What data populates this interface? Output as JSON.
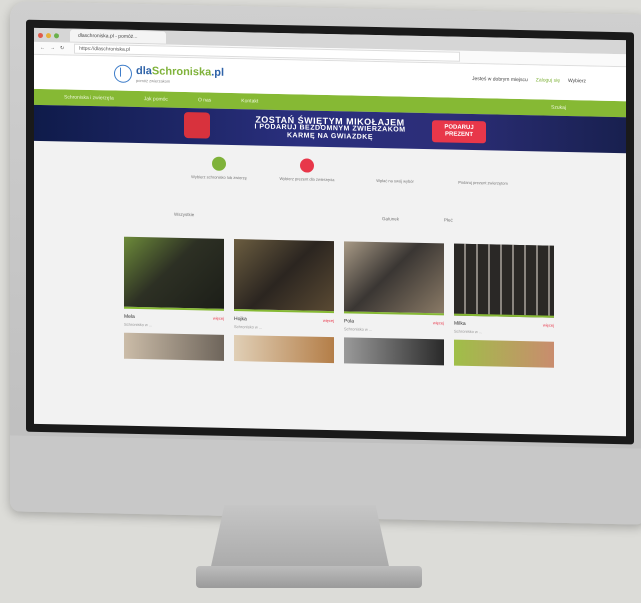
{
  "browser": {
    "tab_title": "dlaschroniska.pl - pomóż...",
    "url": "https://dlaschroniska.pl"
  },
  "site": {
    "logo_prefix": "dla",
    "logo_accent": "Schroniska",
    "logo_suffix": ".pl",
    "tagline": "pomóż zwierzakom",
    "header_links": [
      "Jesteś w dobrym miejscu",
      "Zaloguj się",
      "Wybierz"
    ]
  },
  "nav": {
    "items": [
      "Schroniska i zwierzęta",
      "Jak pomóc",
      "O nas",
      "Kontakt"
    ],
    "right": "Szukaj"
  },
  "banner": {
    "line1": "ZOSTAŃ ŚWIĘTYM MIKOŁAJEM",
    "line2": "I PODARUJ BEZDOMNYM ZWIERZAKOM",
    "line3": "KARMĘ NA GWIAZDKĘ",
    "cta1": "PODARUJ",
    "cta2": "PREZENT"
  },
  "steps": [
    {
      "label": "Wybierz schronisko lub zwierzę",
      "color": "#7fb23a"
    },
    {
      "label": "Wybierz prezent dla zwierzęcia",
      "color": "#e8374a"
    },
    {
      "label": "Wpłać na swój wybór",
      "color": "#f2f2f2"
    },
    {
      "label": "Podaruj prezent zwierzętom",
      "color": "#f2f2f2"
    }
  ],
  "filters": {
    "left": "Wszystkie",
    "mid": "Gatunek",
    "right": "Płeć"
  },
  "cards": [
    {
      "name": "Mela",
      "sub": "Schronisko w ...",
      "more": "więcej",
      "color": "#2d3024"
    },
    {
      "name": "Hojka",
      "sub": "Schronisko w ...",
      "more": "więcej",
      "color": "#5a4a33"
    },
    {
      "name": "Pola",
      "sub": "Schronisko w ...",
      "more": "więcej",
      "color": "#7a6a58"
    },
    {
      "name": "Milka",
      "sub": "Schronisko w ...",
      "more": "więcej",
      "color": "#47443f"
    }
  ],
  "cards_row2": [
    {
      "color": "#9c8a78"
    },
    {
      "color": "#b47e48"
    },
    {
      "color": "#3c3c3c"
    },
    {
      "color": "#c98c6e"
    }
  ]
}
